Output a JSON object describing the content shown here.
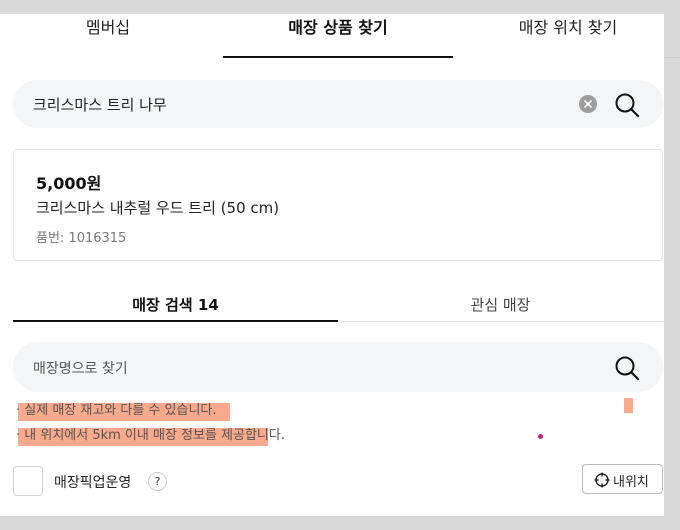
{
  "tabs": [
    {
      "label": "멤버십",
      "active": false
    },
    {
      "label": "매장 상품 찾기",
      "active": true
    },
    {
      "label": "매장 위치 찾기",
      "active": false
    }
  ],
  "search": {
    "value": "크리스마스 트리 나무",
    "clear_icon": "clear-icon",
    "search_icon": "search-icon"
  },
  "product": {
    "price": "5,000원",
    "name": "크리스마스 내추럴 우드 트리 (50 cm)",
    "number": "품번: 1016315"
  },
  "subtabs": [
    {
      "label": "매장 검색 14",
      "active": true
    },
    {
      "label": "관심 매장",
      "active": false
    }
  ],
  "store_search": {
    "placeholder": "매장명으로 찾기"
  },
  "notes": [
    "실제 매장 재고와 다를 수 있습니다.",
    "내 위치에서 5km 이내 매장 정보를 제공합니다."
  ],
  "pickup": {
    "label": "매장픽업운영",
    "help": "?"
  },
  "location_button": {
    "label": "내위치"
  },
  "colors": {
    "highlight": "#f9a98c",
    "accent": "#111111",
    "search_bg": "#f4f5f7"
  }
}
